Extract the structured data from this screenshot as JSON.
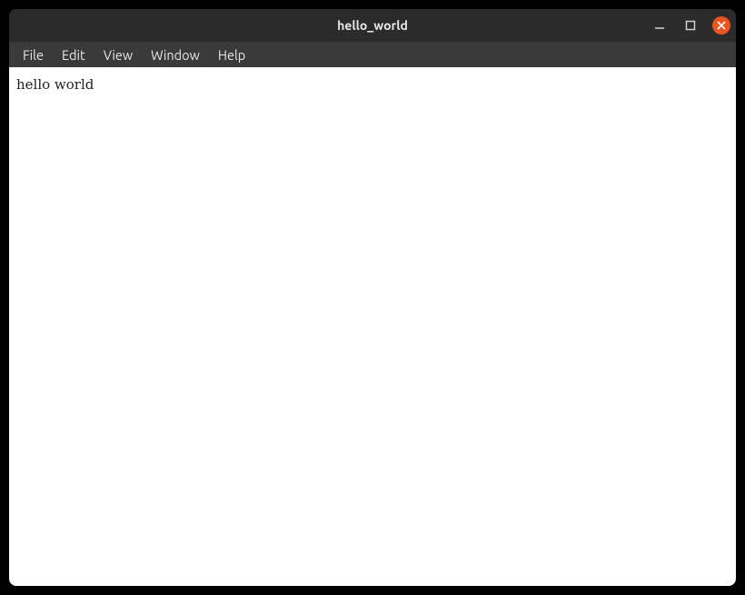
{
  "window": {
    "title": "hello_world"
  },
  "menu": {
    "items": [
      "File",
      "Edit",
      "View",
      "Window",
      "Help"
    ]
  },
  "content": {
    "text": "hello world"
  }
}
